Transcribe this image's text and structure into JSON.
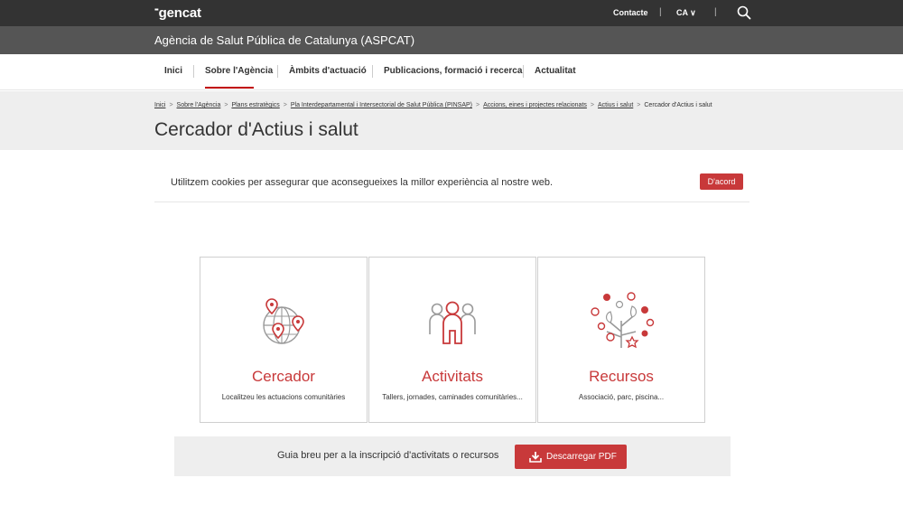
{
  "header": {
    "logo_mark": "▪▪",
    "logo_text": "gencat",
    "contact_label": "Contacte",
    "lang_label": "CA ∨",
    "sep": "|",
    "agency": "Agència de Salut Pública de Catalunya (ASPCAT)"
  },
  "nav": {
    "items": [
      "Inici",
      "Sobre l'Agència",
      "Àmbits d'actuació",
      "Publicacions, formació i recerca",
      "Actualitat"
    ]
  },
  "breadcrumb": {
    "items": [
      "Inici",
      "Sobre l'Agència",
      "Plans estratègics",
      "Pla Interdepartamental i Intersectorial de Salut Pública (PINSAP)",
      "Accions, eines i projectes relacionats",
      "Actius i salut",
      "Cercador d'Actius i salut"
    ],
    "chev": ">"
  },
  "page": {
    "title": "Cercador d'Actius i salut"
  },
  "cookie": {
    "text": "Utilitzem cookies per assegurar que aconsegueixes la millor experiència al nostre web.",
    "button": "D'acord"
  },
  "cards": [
    {
      "title": "Cercador",
      "desc": "Localitzeu les actuacions comunitàries",
      "icon": "globe-pins-icon"
    },
    {
      "title": "Activitats",
      "desc": "Tallers, jornades, caminades comunitàries...",
      "icon": "people-group-icon"
    },
    {
      "title": "Recursos",
      "desc": "Associació, parc, piscina...",
      "icon": "resource-tree-icon"
    }
  ],
  "guide": {
    "text": "Guia breu per a la inscripció d'activitats o recursos",
    "button": "Descarregar PDF"
  },
  "colors": {
    "accent": "#c8393a",
    "topbar": "#333333",
    "agencybar": "#555555",
    "band": "#eeeeee"
  }
}
